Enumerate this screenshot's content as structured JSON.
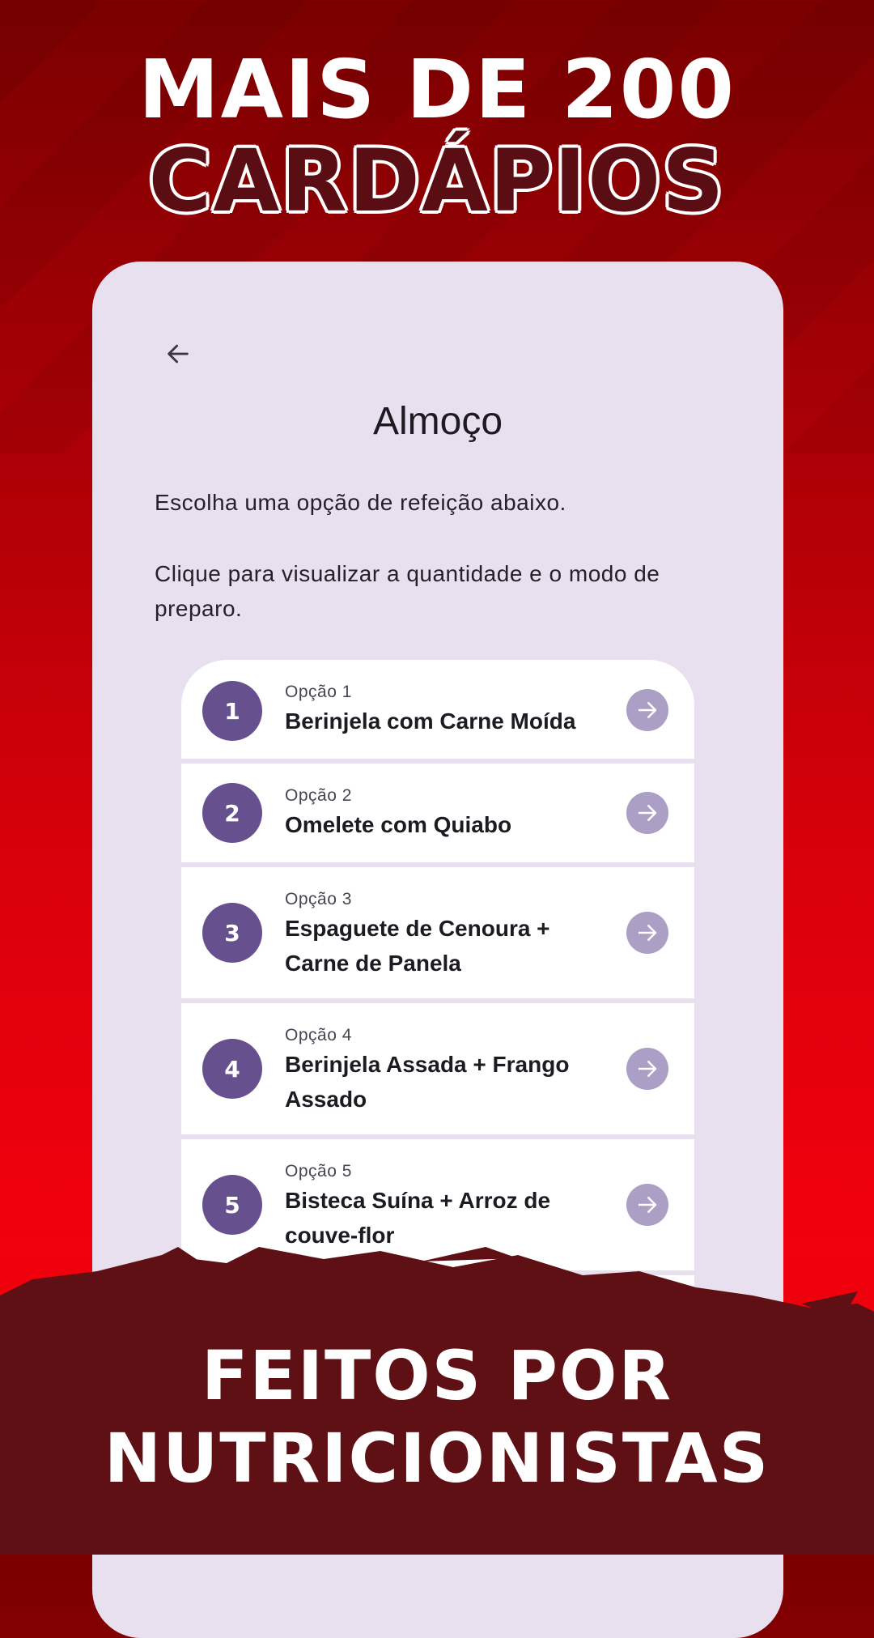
{
  "promo": {
    "headline_line1": "MAIS DE 200",
    "headline_line2": "CARDÁPIOS",
    "footer_line1": "FEITOS POR",
    "footer_line2": "NUTRICIONISTAS"
  },
  "screen": {
    "back_icon": "arrow-left-icon",
    "title": "Almoço",
    "instruction_1": "Escolha uma opção de refeição abaixo.",
    "instruction_2": "Clique para visualizar a quantidade e o modo de preparo.",
    "options": [
      {
        "number": "1",
        "label": "Opção 1",
        "name": "Berinjela com Carne Moída"
      },
      {
        "number": "2",
        "label": "Opção 2",
        "name": "Omelete com Quiabo"
      },
      {
        "number": "3",
        "label": "Opção 3",
        "name": "Espaguete de Cenoura + Carne de Panela"
      },
      {
        "number": "4",
        "label": "Opção 4",
        "name": "Berinjela  Assada + Frango Assado"
      },
      {
        "number": "5",
        "label": "Opção 5",
        "name": "Bisteca Suína + Arroz de couve-flor"
      }
    ]
  },
  "colors": {
    "background_top": "#7a0000",
    "background_bottom": "#f1000d",
    "card_background": "#e8e0ee",
    "number_badge": "#66508e",
    "arrow_button": "#ab9fc6",
    "brush_stroke": "#5e1014"
  }
}
